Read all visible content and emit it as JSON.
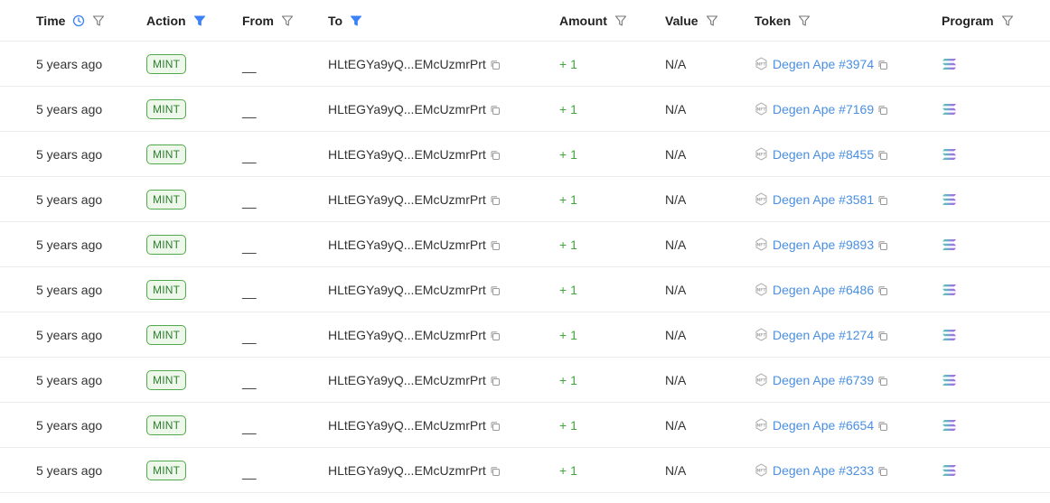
{
  "header": {
    "time": "Time",
    "action": "Action",
    "from": "From",
    "to": "To",
    "amount": "Amount",
    "value": "Value",
    "token": "Token",
    "program": "Program"
  },
  "colors": {
    "accent": "#3b82f6",
    "badge_green": "#2e7d32",
    "amount_green": "#41a63e",
    "link_blue": "#4a8fe0"
  },
  "icons": {
    "time": "clock-icon",
    "filter": "filter-icon",
    "filter_active": "filter-active-icon",
    "copy": "copy-icon",
    "nft": "nft-icon",
    "program": "solana-program-icon"
  },
  "rows": [
    {
      "time": "5 years ago",
      "action": "MINT",
      "from": "__",
      "to": "HLtEGYa9yQ...EMcUzmrPrt",
      "amount": "+ 1",
      "value": "N/A",
      "token": "Degen Ape #3974"
    },
    {
      "time": "5 years ago",
      "action": "MINT",
      "from": "__",
      "to": "HLtEGYa9yQ...EMcUzmrPrt",
      "amount": "+ 1",
      "value": "N/A",
      "token": "Degen Ape #7169"
    },
    {
      "time": "5 years ago",
      "action": "MINT",
      "from": "__",
      "to": "HLtEGYa9yQ...EMcUzmrPrt",
      "amount": "+ 1",
      "value": "N/A",
      "token": "Degen Ape #8455"
    },
    {
      "time": "5 years ago",
      "action": "MINT",
      "from": "__",
      "to": "HLtEGYa9yQ...EMcUzmrPrt",
      "amount": "+ 1",
      "value": "N/A",
      "token": "Degen Ape #3581"
    },
    {
      "time": "5 years ago",
      "action": "MINT",
      "from": "__",
      "to": "HLtEGYa9yQ...EMcUzmrPrt",
      "amount": "+ 1",
      "value": "N/A",
      "token": "Degen Ape #9893"
    },
    {
      "time": "5 years ago",
      "action": "MINT",
      "from": "__",
      "to": "HLtEGYa9yQ...EMcUzmrPrt",
      "amount": "+ 1",
      "value": "N/A",
      "token": "Degen Ape #6486"
    },
    {
      "time": "5 years ago",
      "action": "MINT",
      "from": "__",
      "to": "HLtEGYa9yQ...EMcUzmrPrt",
      "amount": "+ 1",
      "value": "N/A",
      "token": "Degen Ape #1274"
    },
    {
      "time": "5 years ago",
      "action": "MINT",
      "from": "__",
      "to": "HLtEGYa9yQ...EMcUzmrPrt",
      "amount": "+ 1",
      "value": "N/A",
      "token": "Degen Ape #6739"
    },
    {
      "time": "5 years ago",
      "action": "MINT",
      "from": "__",
      "to": "HLtEGYa9yQ...EMcUzmrPrt",
      "amount": "+ 1",
      "value": "N/A",
      "token": "Degen Ape #6654"
    },
    {
      "time": "5 years ago",
      "action": "MINT",
      "from": "__",
      "to": "HLtEGYa9yQ...EMcUzmrPrt",
      "amount": "+ 1",
      "value": "N/A",
      "token": "Degen Ape #3233"
    }
  ]
}
